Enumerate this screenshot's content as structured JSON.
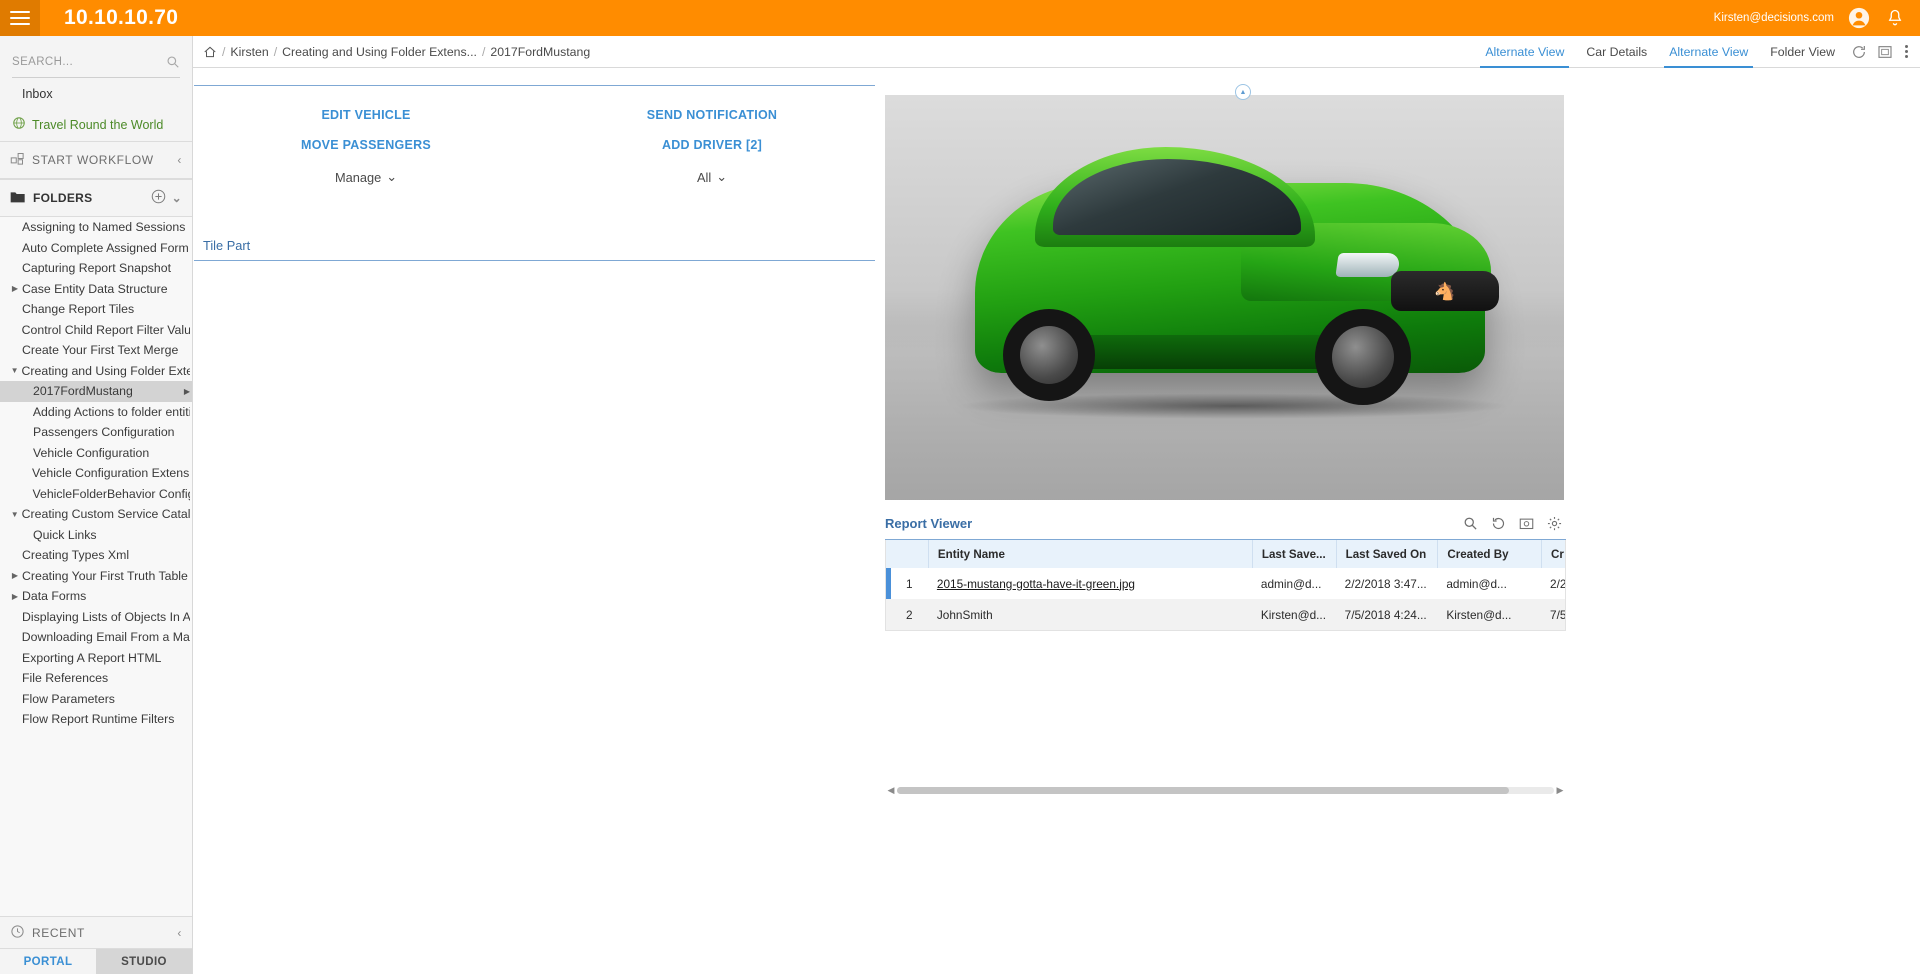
{
  "topbar": {
    "menu_icon": "hamburger-icon",
    "title": "10.10.10.70",
    "user_email": "Kirsten@decisions.com",
    "account_icon": "user-account-icon",
    "notification_icon": "bell-icon",
    "background": "#FF8C00"
  },
  "sidebar": {
    "search": {
      "value": "",
      "placeholder": "SEARCH..."
    },
    "inbox_label": "Inbox",
    "travel_label": "Travel Round the World",
    "start_workflow_label": "START WORKFLOW",
    "folders_label": "FOLDERS",
    "recent_label": "RECENT",
    "tabs": [
      {
        "label": "PORTAL",
        "active": true
      },
      {
        "label": "STUDIO",
        "active": false
      }
    ],
    "tree": [
      {
        "label": "Assigning to Named Sessions",
        "indent": 1,
        "twisty": "none",
        "selected": false
      },
      {
        "label": "Auto Complete Assigned Form",
        "indent": 1,
        "twisty": "none",
        "selected": false
      },
      {
        "label": "Capturing Report Snapshot",
        "indent": 1,
        "twisty": "none",
        "selected": false
      },
      {
        "label": "Case Entity Data Structure",
        "indent": 1,
        "twisty": "collapsed",
        "selected": false
      },
      {
        "label": "Change Report Tiles",
        "indent": 1,
        "twisty": "none",
        "selected": false
      },
      {
        "label": "Control Child Report Filter Value",
        "indent": 1,
        "twisty": "none",
        "selected": false
      },
      {
        "label": "Create Your First Text Merge",
        "indent": 1,
        "twisty": "none",
        "selected": false
      },
      {
        "label": "Creating and Using Folder Exten",
        "indent": 1,
        "twisty": "expanded",
        "selected": false
      },
      {
        "label": "2017FordMustang",
        "indent": 2,
        "twisty": "none",
        "selected": true,
        "arrow": true
      },
      {
        "label": "Adding Actions to folder entiti",
        "indent": 2,
        "twisty": "none",
        "selected": false
      },
      {
        "label": "Passengers Configuration",
        "indent": 2,
        "twisty": "none",
        "selected": false
      },
      {
        "label": "Vehicle Configuration",
        "indent": 2,
        "twisty": "none",
        "selected": false
      },
      {
        "label": "Vehicle Configuration Extensio",
        "indent": 2,
        "twisty": "none",
        "selected": false
      },
      {
        "label": "VehicleFolderBehavior Config",
        "indent": 2,
        "twisty": "none",
        "selected": false
      },
      {
        "label": "Creating Custom Service Catalo",
        "indent": 1,
        "twisty": "expanded",
        "selected": false
      },
      {
        "label": "Quick Links",
        "indent": 2,
        "twisty": "none",
        "selected": false
      },
      {
        "label": "Creating Types Xml",
        "indent": 1,
        "twisty": "none",
        "selected": false
      },
      {
        "label": "Creating Your First Truth Table",
        "indent": 1,
        "twisty": "collapsed",
        "selected": false
      },
      {
        "label": "Data Forms",
        "indent": 1,
        "twisty": "collapsed",
        "selected": false
      },
      {
        "label": "Displaying Lists of Objects In A",
        "indent": 1,
        "twisty": "none",
        "selected": false
      },
      {
        "label": "Downloading Email From a Mail",
        "indent": 1,
        "twisty": "none",
        "selected": false
      },
      {
        "label": "Exporting A Report HTML",
        "indent": 1,
        "twisty": "none",
        "selected": false
      },
      {
        "label": "File References",
        "indent": 1,
        "twisty": "none",
        "selected": false
      },
      {
        "label": "Flow Parameters",
        "indent": 1,
        "twisty": "none",
        "selected": false
      },
      {
        "label": "Flow Report Runtime Filters",
        "indent": 1,
        "twisty": "none",
        "selected": false
      }
    ]
  },
  "breadcrumb": {
    "home_icon": "home-icon",
    "items": [
      "Kirsten",
      "Creating and Using Folder Extens...",
      "2017FordMustang"
    ]
  },
  "view_tabs": [
    {
      "label": "Alternate View",
      "active": true
    },
    {
      "label": "Car Details",
      "active": false
    },
    {
      "label": "Alternate View",
      "active": true
    },
    {
      "label": "Folder View",
      "active": false
    }
  ],
  "toolbar_icons": [
    "refresh-icon",
    "fullscreen-icon",
    "kebab-menu-icon"
  ],
  "actions": {
    "left_column": {
      "links": [
        "EDIT VEHICLE",
        "MOVE PASSENGERS"
      ],
      "dropdown": "Manage"
    },
    "right_column": {
      "links": [
        "SEND NOTIFICATION",
        "ADD DRIVER [2]"
      ],
      "dropdown": "All"
    }
  },
  "tile_part": {
    "title": "Tile Part"
  },
  "car_image": {
    "alt": "green-2017-ford-mustang-photo"
  },
  "report_viewer": {
    "title": "Report Viewer",
    "tools": [
      "search-icon",
      "refresh-icon",
      "snapshot-icon",
      "gear-icon"
    ],
    "columns": [
      "",
      "Entity Name",
      "Last Save...",
      "Last Saved On",
      "Created By",
      "Cr"
    ],
    "rows": [
      {
        "index": "1",
        "entity_name": "2015-mustang-gotta-have-it-green.jpg",
        "last_saved_by": "admin@d...",
        "last_saved_on": "2/2/2018 3:47...",
        "created_by": "admin@d...",
        "created_on": "2/2",
        "selected": true,
        "is_link": true
      },
      {
        "index": "2",
        "entity_name": "JohnSmith",
        "last_saved_by": "Kirsten@d...",
        "last_saved_on": "7/5/2018 4:24...",
        "created_by": "Kirsten@d...",
        "created_on": "7/5",
        "selected": false,
        "is_link": false
      }
    ]
  },
  "colors": {
    "brand_orange": "#FF8C00",
    "link_blue": "#3A8FD4",
    "header_blue": "#3A6EA5",
    "grid_header_bg": "#E8F2FB",
    "green_link": "#4C8A28",
    "selection_gray": "#D3D3D3"
  }
}
